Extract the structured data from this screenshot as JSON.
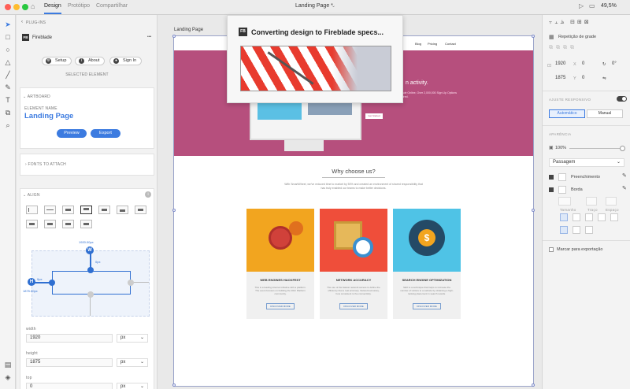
{
  "window": {
    "title": "Landing Page *",
    "tabs": [
      "Design",
      "Protótipo",
      "Compartilhar"
    ],
    "zoom": "49,5%"
  },
  "plugin": {
    "header": "PLUG-INS",
    "name": "Fireblade",
    "logo_text": "FB",
    "more": "•••",
    "buttons": {
      "setup": "Setup",
      "about": "About",
      "signin": "Sign In"
    },
    "selected_label": "SELECTED ELEMENT",
    "artboard_section": "ARTBOARD",
    "element_name_label": "ELEMENT NAME",
    "element_name": "Landing Page",
    "preview": "Preview",
    "export": "Export",
    "fonts_section": "FONTS TO ATTACH",
    "align_section": "ALIGN",
    "constraint_w": "W",
    "constraint_h": "H",
    "w_value": "1920.00px",
    "h_value": "1875.00px",
    "w_offset": "0px",
    "h_offset": "0px",
    "fields": [
      {
        "label": "width",
        "value": "1920",
        "unit": "px"
      },
      {
        "label": "height",
        "value": "1875",
        "unit": "px"
      },
      {
        "label": "top",
        "value": "0",
        "unit": "px"
      }
    ]
  },
  "canvas": {
    "artboard_label": "Landing Page",
    "nav": [
      "Blog",
      "Pricing",
      "Contact"
    ],
    "hero_heading": "n activity.",
    "hero_text": "Frees Tasks, Get Setup in chedule Online, Over 2,000,000 Sign Up Options Available, No Credit Card Required.",
    "hero_button": "Get Started",
    "why_title": "Why choose us?",
    "why_text": "With SmartWheel, we've reduced time to market by 50% and created an environment of shared responsibility that has truly enabled our teams to make better decisions.",
    "features": [
      {
        "title": "WEB ENGINES HACKFEST",
        "desc": "This is a leading internet initiative with a platform. The event focuses on building the Web Platform community.",
        "button": "DISCOVER MORE",
        "color": "#f2a51f"
      },
      {
        "title": "NETWORK ACCURACY",
        "desc": "The use of the fastest network access to define the efficiency that a real accuracy. Network accuracy, how consistent is the connectivity.",
        "button": "DISCOVER MORE",
        "color": "#ef4e3a"
      },
      {
        "title": "SEARCH ENGINE OPTIMIZATION",
        "desc": "SEO is a technique that helps to increase the number of visitors to a website by obtaining a high-ranking placement in search results.",
        "button": "DISCOVER MORE",
        "color": "#4fc3e6"
      }
    ]
  },
  "modal": {
    "logo_text": "FB",
    "text": "Converting design to Fireblade specs..."
  },
  "props": {
    "repeat_grid": "Repetição de grade",
    "x": "1920",
    "x_label": "X",
    "y": "1875",
    "y_label": "Y",
    "zero1": "0",
    "zero2": "0",
    "rotation": "0°",
    "responsive_label": "AJUSTE RESPONSIVO",
    "auto": "Automático",
    "manual": "Manual",
    "appearance_label": "APARÊNCIA",
    "opacity": "100%",
    "blend": "Passagem",
    "fill_label": "Preenchimento",
    "border_label": "Borda",
    "border_sub": [
      "Tamanho",
      "Traço",
      "Espaço"
    ],
    "export_mark": "Marcar para exportação"
  },
  "colors": {
    "hero": "#b64f7d",
    "accent_blue": "#3c7be0",
    "selection": "#7b89c9"
  }
}
